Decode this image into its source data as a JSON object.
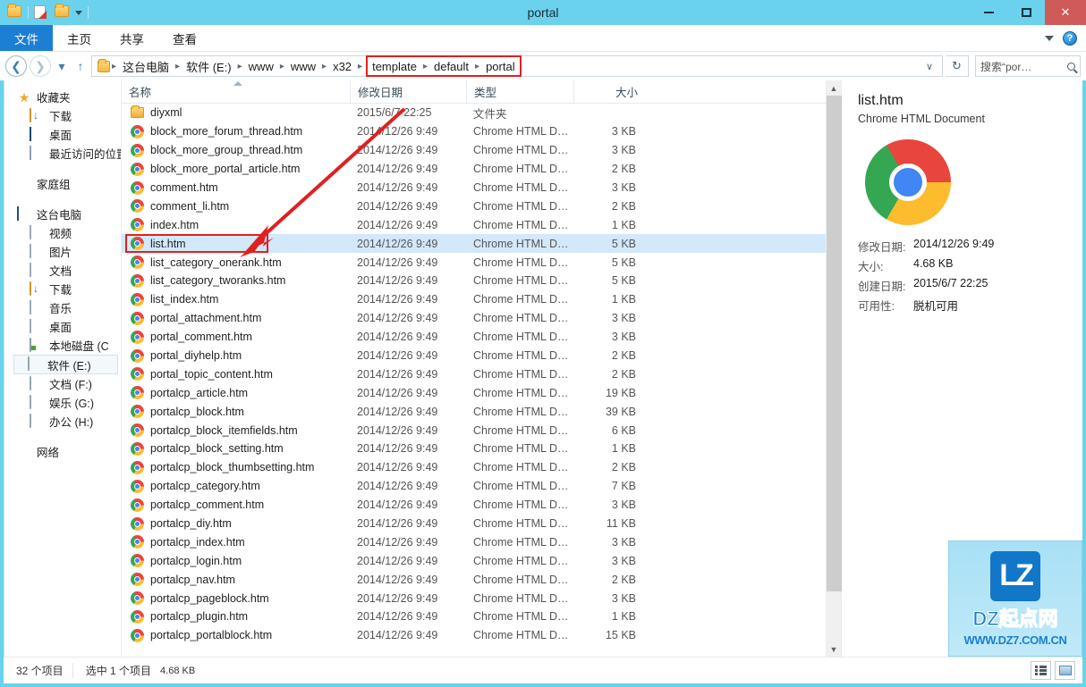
{
  "titlebar": {
    "title": "portal",
    "quick_access": [
      "folder-icon",
      "properties-icon",
      "new-folder-icon",
      "dropdown-caret-icon"
    ],
    "minimize": "–",
    "maximize": "□",
    "close": "✕"
  },
  "ribbon": {
    "tabs": [
      {
        "label": "文件",
        "active": true
      },
      {
        "label": "主页",
        "active": false
      },
      {
        "label": "共享",
        "active": false
      },
      {
        "label": "查看",
        "active": false
      }
    ],
    "help_label": "?"
  },
  "addressbar": {
    "back": "←",
    "forward": "→",
    "history_caret": "▾",
    "up": "↑",
    "crumbs": [
      "这台电脑",
      "软件 (E:)",
      "www",
      "www",
      "x32"
    ],
    "highlighted_crumbs": [
      "template",
      "default",
      "portal"
    ],
    "separator": "▸",
    "dropdown": "∨",
    "refresh": "↻",
    "search_placeholder": "搜索“por…",
    "search_value": ""
  },
  "navpane": {
    "groups": [
      {
        "header": {
          "label": "收藏夹",
          "icon": "star-icon"
        },
        "items": [
          {
            "label": "下载",
            "icon": "download-folder-icon"
          },
          {
            "label": "桌面",
            "icon": "desktop-icon"
          },
          {
            "label": "最近访问的位置",
            "icon": "recent-places-icon"
          }
        ]
      },
      {
        "header": {
          "label": "家庭组",
          "icon": "homegroup-icon"
        },
        "items": []
      },
      {
        "header": {
          "label": "这台电脑",
          "icon": "this-pc-icon"
        },
        "items": [
          {
            "label": "视频",
            "icon": "videos-icon"
          },
          {
            "label": "图片",
            "icon": "pictures-icon"
          },
          {
            "label": "文档",
            "icon": "documents-icon"
          },
          {
            "label": "下载",
            "icon": "downloads-icon"
          },
          {
            "label": "音乐",
            "icon": "music-icon"
          },
          {
            "label": "桌面",
            "icon": "desktop-lib-icon"
          },
          {
            "label": "本地磁盘 (C",
            "icon": "local-disk-icon"
          },
          {
            "label": "软件 (E:)",
            "icon": "drive-icon",
            "selected": true
          },
          {
            "label": "文档 (F:)",
            "icon": "drive-icon"
          },
          {
            "label": "娱乐 (G:)",
            "icon": "drive-icon"
          },
          {
            "label": "办公 (H:)",
            "icon": "drive-icon"
          }
        ]
      },
      {
        "header": {
          "label": "网络",
          "icon": "network-icon"
        },
        "items": []
      }
    ]
  },
  "filelist": {
    "columns": [
      "名称",
      "修改日期",
      "类型",
      "大小"
    ],
    "sorted_column": "名称",
    "rows": [
      {
        "name": "diyxml",
        "date": "2015/6/7 22:25",
        "type": "文件夹",
        "size": "",
        "icon": "folder-icon"
      },
      {
        "name": "block_more_forum_thread.htm",
        "date": "2014/12/26 9:49",
        "type": "Chrome HTML D…",
        "size": "3 KB",
        "icon": "chrome-icon"
      },
      {
        "name": "block_more_group_thread.htm",
        "date": "2014/12/26 9:49",
        "type": "Chrome HTML D…",
        "size": "3 KB",
        "icon": "chrome-icon"
      },
      {
        "name": "block_more_portal_article.htm",
        "date": "2014/12/26 9:49",
        "type": "Chrome HTML D…",
        "size": "2 KB",
        "icon": "chrome-icon"
      },
      {
        "name": "comment.htm",
        "date": "2014/12/26 9:49",
        "type": "Chrome HTML D…",
        "size": "3 KB",
        "icon": "chrome-icon"
      },
      {
        "name": "comment_li.htm",
        "date": "2014/12/26 9:49",
        "type": "Chrome HTML D…",
        "size": "2 KB",
        "icon": "chrome-icon"
      },
      {
        "name": "index.htm",
        "date": "2014/12/26 9:49",
        "type": "Chrome HTML D…",
        "size": "1 KB",
        "icon": "chrome-icon"
      },
      {
        "name": "list.htm",
        "date": "2014/12/26 9:49",
        "type": "Chrome HTML D…",
        "size": "5 KB",
        "icon": "chrome-icon",
        "selected": true,
        "highlighted": true
      },
      {
        "name": "list_category_onerank.htm",
        "date": "2014/12/26 9:49",
        "type": "Chrome HTML D…",
        "size": "5 KB",
        "icon": "chrome-icon"
      },
      {
        "name": "list_category_tworanks.htm",
        "date": "2014/12/26 9:49",
        "type": "Chrome HTML D…",
        "size": "5 KB",
        "icon": "chrome-icon"
      },
      {
        "name": "list_index.htm",
        "date": "2014/12/26 9:49",
        "type": "Chrome HTML D…",
        "size": "1 KB",
        "icon": "chrome-icon"
      },
      {
        "name": "portal_attachment.htm",
        "date": "2014/12/26 9:49",
        "type": "Chrome HTML D…",
        "size": "3 KB",
        "icon": "chrome-icon"
      },
      {
        "name": "portal_comment.htm",
        "date": "2014/12/26 9:49",
        "type": "Chrome HTML D…",
        "size": "3 KB",
        "icon": "chrome-icon"
      },
      {
        "name": "portal_diyhelp.htm",
        "date": "2014/12/26 9:49",
        "type": "Chrome HTML D…",
        "size": "2 KB",
        "icon": "chrome-icon"
      },
      {
        "name": "portal_topic_content.htm",
        "date": "2014/12/26 9:49",
        "type": "Chrome HTML D…",
        "size": "2 KB",
        "icon": "chrome-icon"
      },
      {
        "name": "portalcp_article.htm",
        "date": "2014/12/26 9:49",
        "type": "Chrome HTML D…",
        "size": "19 KB",
        "icon": "chrome-icon"
      },
      {
        "name": "portalcp_block.htm",
        "date": "2014/12/26 9:49",
        "type": "Chrome HTML D…",
        "size": "39 KB",
        "icon": "chrome-icon"
      },
      {
        "name": "portalcp_block_itemfields.htm",
        "date": "2014/12/26 9:49",
        "type": "Chrome HTML D…",
        "size": "6 KB",
        "icon": "chrome-icon"
      },
      {
        "name": "portalcp_block_setting.htm",
        "date": "2014/12/26 9:49",
        "type": "Chrome HTML D…",
        "size": "1 KB",
        "icon": "chrome-icon"
      },
      {
        "name": "portalcp_block_thumbsetting.htm",
        "date": "2014/12/26 9:49",
        "type": "Chrome HTML D…",
        "size": "2 KB",
        "icon": "chrome-icon"
      },
      {
        "name": "portalcp_category.htm",
        "date": "2014/12/26 9:49",
        "type": "Chrome HTML D…",
        "size": "7 KB",
        "icon": "chrome-icon"
      },
      {
        "name": "portalcp_comment.htm",
        "date": "2014/12/26 9:49",
        "type": "Chrome HTML D…",
        "size": "3 KB",
        "icon": "chrome-icon"
      },
      {
        "name": "portalcp_diy.htm",
        "date": "2014/12/26 9:49",
        "type": "Chrome HTML D…",
        "size": "11 KB",
        "icon": "chrome-icon"
      },
      {
        "name": "portalcp_index.htm",
        "date": "2014/12/26 9:49",
        "type": "Chrome HTML D…",
        "size": "3 KB",
        "icon": "chrome-icon"
      },
      {
        "name": "portalcp_login.htm",
        "date": "2014/12/26 9:49",
        "type": "Chrome HTML D…",
        "size": "3 KB",
        "icon": "chrome-icon"
      },
      {
        "name": "portalcp_nav.htm",
        "date": "2014/12/26 9:49",
        "type": "Chrome HTML D…",
        "size": "2 KB",
        "icon": "chrome-icon"
      },
      {
        "name": "portalcp_pageblock.htm",
        "date": "2014/12/26 9:49",
        "type": "Chrome HTML D…",
        "size": "3 KB",
        "icon": "chrome-icon"
      },
      {
        "name": "portalcp_plugin.htm",
        "date": "2014/12/26 9:49",
        "type": "Chrome HTML D…",
        "size": "1 KB",
        "icon": "chrome-icon"
      },
      {
        "name": "portalcp_portalblock.htm",
        "date": "2014/12/26 9:49",
        "type": "Chrome HTML D…",
        "size": "15 KB",
        "icon": "chrome-icon"
      }
    ]
  },
  "details": {
    "filename": "list.htm",
    "filetype": "Chrome HTML Document",
    "icon": "chrome-icon",
    "properties": [
      {
        "label": "修改日期:",
        "value": "2014/12/26 9:49"
      },
      {
        "label": "大小:",
        "value": "4.68 KB"
      },
      {
        "label": "创建日期:",
        "value": "2015/6/7 22:25"
      },
      {
        "label": "可用性:",
        "value": "脱机可用"
      }
    ]
  },
  "statusbar": {
    "item_count": "32 个项目",
    "selection": "选中 1 个项目",
    "selection_size": "4.68 KB",
    "view_details": "details-view-icon",
    "view_tiles": "tiles-view-icon"
  },
  "watermark": {
    "logo": "LZ",
    "line1": "DZ起点网",
    "line2": "WWW.DZ7.COM.CN"
  },
  "annotation": {
    "arrow_color": "#e02020",
    "description": "red-arrow-pointing-to-list-htm"
  }
}
